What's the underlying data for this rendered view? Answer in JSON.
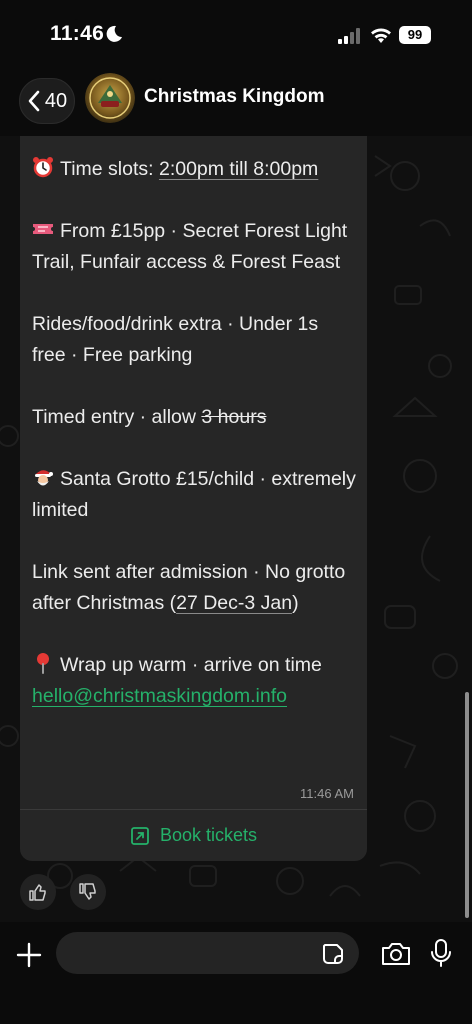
{
  "status_bar": {
    "time": "11:46",
    "battery": "99"
  },
  "header": {
    "back_count": "40",
    "title": "Christmas Kingdom"
  },
  "message": {
    "slots_prefix": "Time slots: ",
    "slots_value": "2:00pm till 8:00pm",
    "price_line": "From £15pp · Secret Forest Light Trail, Funfair access & Forest Feast",
    "extras_line": "Rides/food/drink extra · Under 1s free · Free parking",
    "timed_prefix": "Timed entry · allow ",
    "timed_struck": "3 hours",
    "santa_line": "Santa Grotto £15/child · extremely limited",
    "link_prefix": "Link sent after admission · No grotto after Christmas (",
    "link_dates": "27 Dec-3 Jan",
    "link_suffix": ")",
    "wrap_line": "Wrap up warm · arrive on time",
    "email": "hello@christmaskingdom.info",
    "time": "11:46 AM"
  },
  "action": {
    "book_label": "Book tickets"
  },
  "icons": {
    "alarm": "alarm-clock-icon",
    "ticket": "ticket-icon",
    "santa": "santa-icon",
    "pin": "pushpin-icon",
    "book": "external-link-icon",
    "like": "thumbs-up-icon",
    "dislike": "thumbs-down-icon",
    "plus": "plus-icon",
    "sticker": "sticker-icon",
    "camera": "camera-icon",
    "mic": "microphone-icon"
  },
  "colors": {
    "accent": "#25b16a",
    "bubble": "#262626",
    "background": "#0b0b0b"
  }
}
